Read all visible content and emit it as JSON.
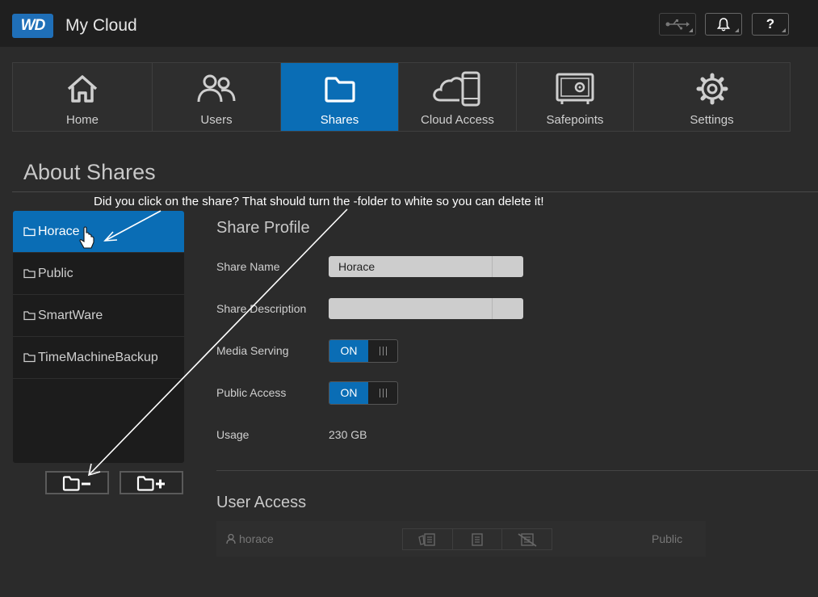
{
  "header": {
    "logo_text": "WD",
    "app_title": "My Cloud",
    "buttons": [
      {
        "name": "usb-icon"
      },
      {
        "name": "bell-icon"
      },
      {
        "name": "help-icon",
        "label": "?"
      }
    ]
  },
  "nav": {
    "items": [
      {
        "label": "Home",
        "icon": "home-icon"
      },
      {
        "label": "Users",
        "icon": "users-icon"
      },
      {
        "label": "Shares",
        "icon": "folder-icon",
        "active": true
      },
      {
        "label": "Cloud Access",
        "icon": "cloud-device-icon"
      },
      {
        "label": "Safepoints",
        "icon": "safe-icon"
      },
      {
        "label": "Settings",
        "icon": "gear-icon"
      }
    ]
  },
  "page": {
    "title": "About Shares",
    "annotation": "Did you click on the share? That should turn the -folder to white so you can delete it!"
  },
  "shares": {
    "items": [
      "Horace",
      "Public",
      "SmartWare",
      "TimeMachineBackup"
    ],
    "selected": "Horace"
  },
  "profile": {
    "title": "Share Profile",
    "share_name_label": "Share Name",
    "share_name_value": "Horace",
    "share_description_label": "Share Description",
    "share_description_value": "",
    "media_serving_label": "Media Serving",
    "media_serving_state": "ON",
    "public_access_label": "Public Access",
    "public_access_state": "ON",
    "usage_label": "Usage",
    "usage_value": "230 GB"
  },
  "user_access": {
    "title": "User Access",
    "rows": [
      {
        "user": "horace",
        "status": "Public"
      }
    ]
  },
  "colors": {
    "accent": "#0a6db5",
    "background": "#2b2b2b",
    "topbar": "#1f1f1f"
  }
}
